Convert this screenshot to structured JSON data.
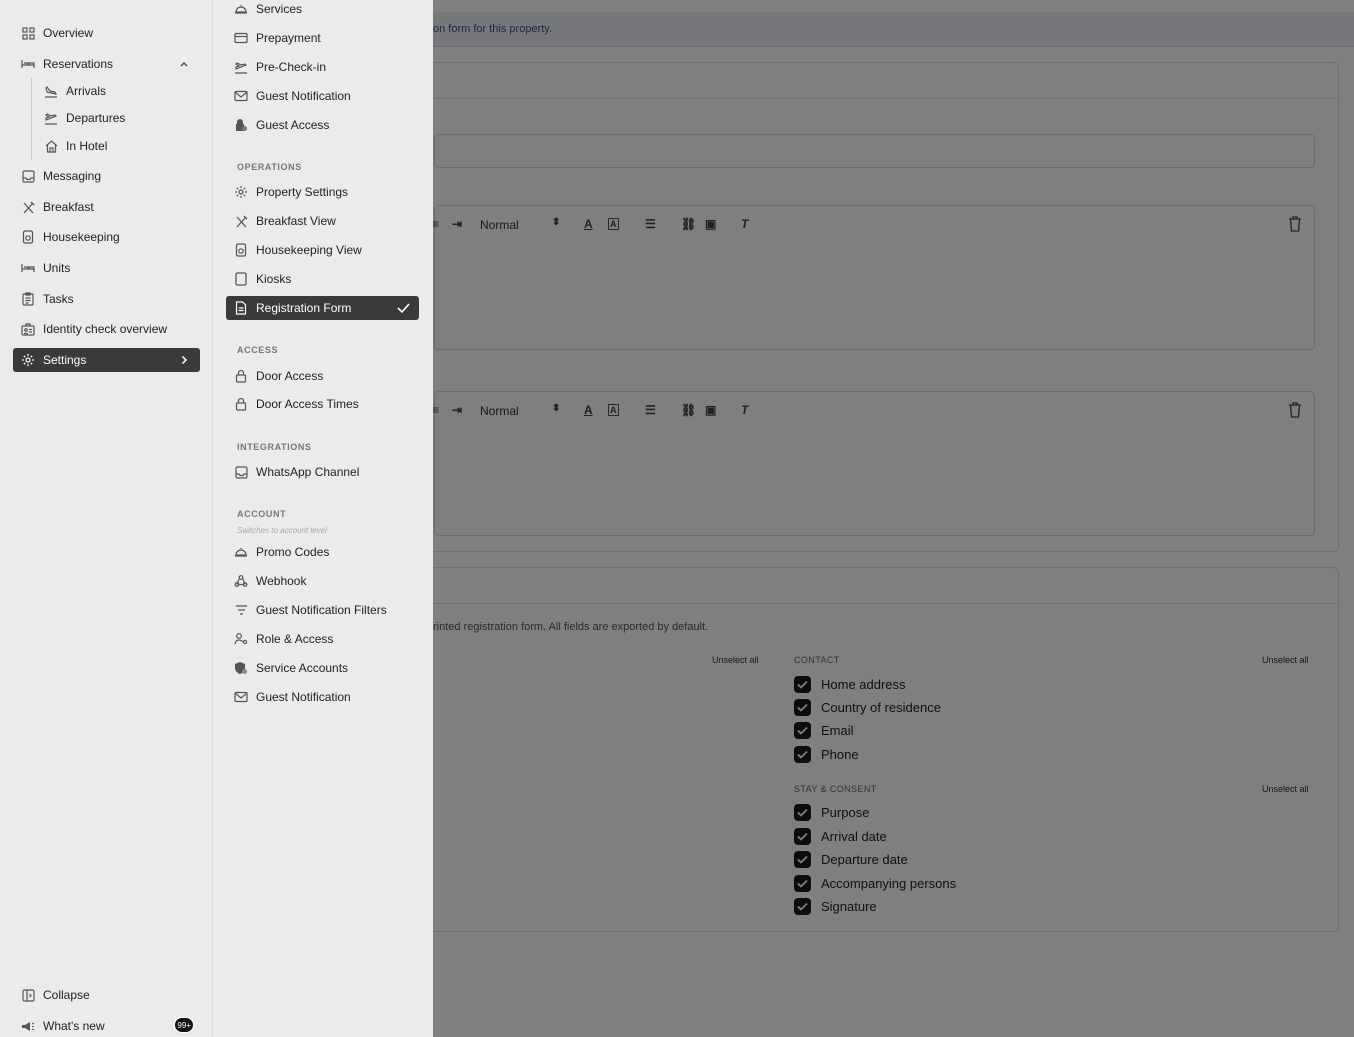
{
  "sidebar": {
    "items": [
      {
        "label": "Overview",
        "icon": "grid-icon"
      },
      {
        "label": "Reservations",
        "icon": "bed-icon"
      },
      {
        "label": "Arrivals",
        "icon": "plane-landing-icon"
      },
      {
        "label": "Departures",
        "icon": "plane-takeoff-icon"
      },
      {
        "label": "In Hotel",
        "icon": "home-icon"
      },
      {
        "label": "Messaging",
        "icon": "inbox-icon"
      },
      {
        "label": "Breakfast",
        "icon": "utensils-icon"
      },
      {
        "label": "Housekeeping",
        "icon": "spray-bottle-icon"
      },
      {
        "label": "Units",
        "icon": "bed-icon"
      },
      {
        "label": "Tasks",
        "icon": "clipboard-icon"
      },
      {
        "label": "Identity check overview",
        "icon": "id-card-icon"
      },
      {
        "label": "Settings",
        "icon": "gear-icon"
      }
    ],
    "collapse_label": "Collapse",
    "whats_new_label": "What's new",
    "whats_new_badge": "99+"
  },
  "submenu": {
    "top_items": [
      "Services",
      "Prepayment",
      "Pre-Check-in",
      "Guest Notification",
      "Guest Access"
    ],
    "operations_title": "OPERATIONS",
    "operations_items": [
      "Property Settings",
      "Breakfast View",
      "Housekeeping View",
      "Kiosks",
      "Registration Form"
    ],
    "access_title": "ACCESS",
    "access_items": [
      "Door Access",
      "Door Access Times"
    ],
    "integrations_title": "INTEGRATIONS",
    "integrations_items": [
      "WhatsApp Channel"
    ],
    "account_title": "ACCOUNT",
    "account_hint": "Switches to account level",
    "account_items": [
      "Promo Codes",
      "Webhook",
      "Guest Notification Filters",
      "Role & Access",
      "Service Accounts",
      "Guest Notification"
    ]
  },
  "main": {
    "banner_text": "on form for this property.",
    "editor_style_value": "Normal",
    "export_helper": "rinted registration form. All fields are exported by default.",
    "unselect_label": "Unselect all",
    "contact_title": "CONTACT",
    "contact_fields": [
      "Home address",
      "Country of residence",
      "Email",
      "Phone"
    ],
    "stay_title": "STAY & CONSENT",
    "stay_fields": [
      "Purpose",
      "Arrival date",
      "Departure date",
      "Accompanying persons",
      "Signature"
    ]
  },
  "colors": {
    "active_bg": "#3a3a3a",
    "sidebar_bg": "#ebebeb",
    "overlay": "rgba(0,0,0,0.5)",
    "banner_bg": "#eef1f8"
  }
}
